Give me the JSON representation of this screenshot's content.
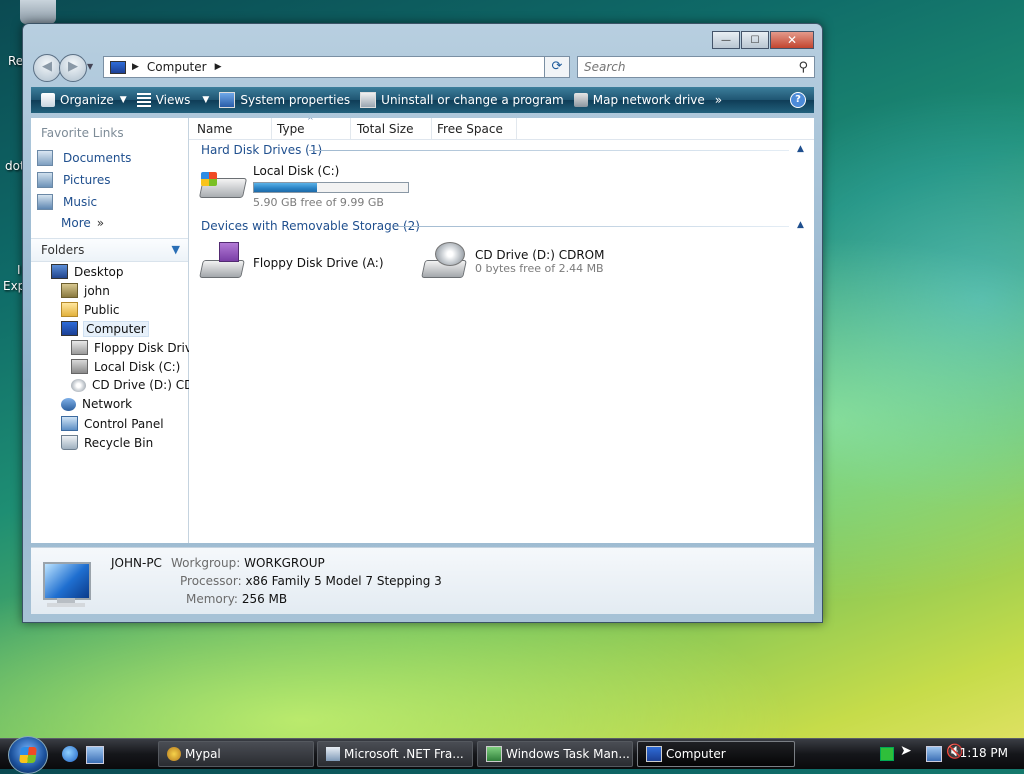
{
  "desktop": {
    "partial_labels": [
      "Re",
      "dot",
      "I",
      "Exp"
    ]
  },
  "window": {
    "buttons": {
      "minimize": "—",
      "maximize": "☐",
      "close": "✕"
    },
    "address": {
      "location": "Computer"
    },
    "search": {
      "placeholder": "Search"
    },
    "toolbar": {
      "organize": "Organize",
      "views": "Views",
      "system_properties": "System properties",
      "uninstall": "Uninstall or change a program",
      "map_network": "Map network drive",
      "more": "»"
    },
    "favorite_links": {
      "title": "Favorite Links",
      "items": [
        "Documents",
        "Pictures",
        "Music"
      ],
      "more": "More"
    },
    "folders": {
      "title": "Folders",
      "tree": [
        "Desktop",
        "john",
        "Public",
        "Computer",
        "Floppy Disk Drive",
        "Local Disk (C:)",
        "CD Drive (D:) CDR",
        "Network",
        "Control Panel",
        "Recycle Bin"
      ]
    },
    "columns": [
      "Name",
      "Type",
      "Total Size",
      "Free Space"
    ],
    "groups": [
      {
        "title": "Hard Disk Drives (1)",
        "items": [
          {
            "name": "Local Disk (C:)",
            "sub": "5.90 GB free of 9.99 GB",
            "usage_fraction": 0.41
          }
        ]
      },
      {
        "title": "Devices with Removable Storage (2)",
        "items": [
          {
            "name": "Floppy Disk Drive (A:)"
          },
          {
            "name": "CD Drive (D:) CDROM",
            "sub": "0 bytes free of 2.44 MB"
          }
        ]
      }
    ],
    "details": {
      "computer_name": "JOHN-PC",
      "workgroup_label": "Workgroup:",
      "workgroup": "WORKGROUP",
      "processor_label": "Processor:",
      "processor": "x86 Family 5 Model 7 Stepping 3",
      "memory_label": "Memory:",
      "memory": "256 MB"
    }
  },
  "taskbar": {
    "buttons": [
      "Mypal",
      "Microsoft .NET Fra...",
      "Windows Task Man...",
      "Computer"
    ],
    "clock": "1:18 PM"
  }
}
